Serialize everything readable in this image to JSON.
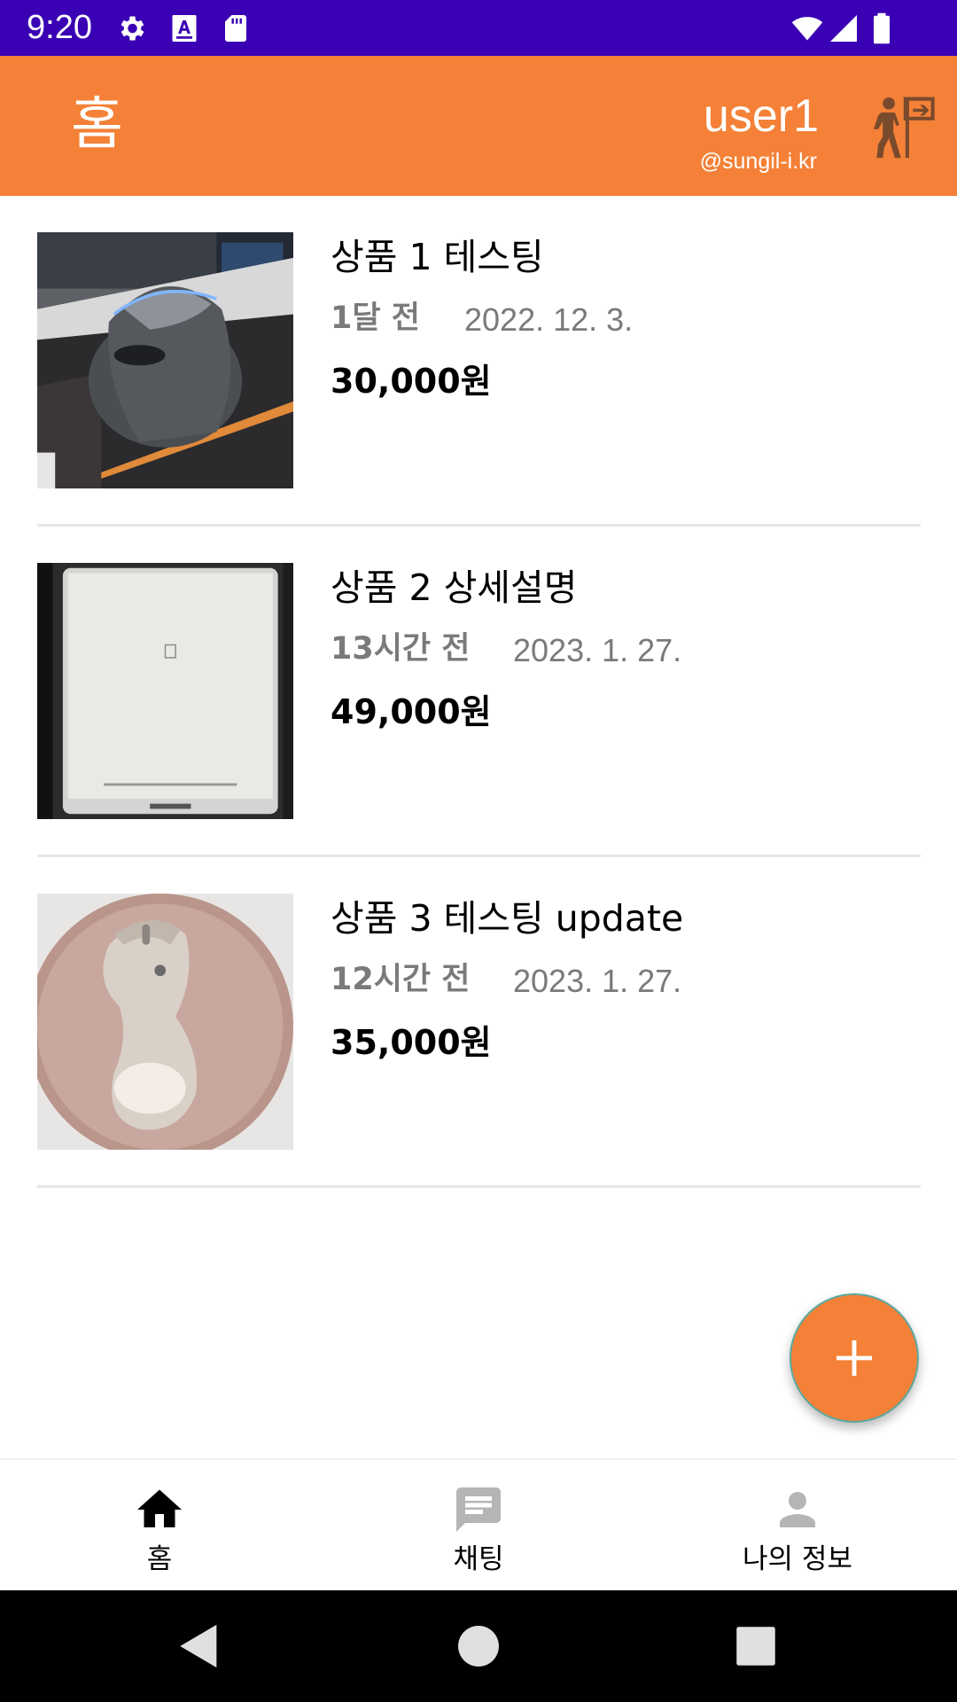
{
  "status_bar": {
    "time": "9:20",
    "left_icons": [
      "settings-icon",
      "a-font-icon",
      "sd-card-icon"
    ],
    "right_icons": [
      "wifi-icon",
      "signal-icon",
      "battery-icon"
    ],
    "background": "#3a00b4"
  },
  "app_bar": {
    "title": "홈",
    "username": "user1",
    "handle": "@sungil-i.kr",
    "action_icon": "logout-exit-icon",
    "background": "#f48137"
  },
  "products": [
    {
      "title": "상품 1 테스팅",
      "ago": "1달 전",
      "date": "2022. 12. 3.",
      "price": "30,000원",
      "image": "vertical-mouse-photo"
    },
    {
      "title": "상품 2  상세설명",
      "ago": "13시간 전",
      "date": "2023. 1. 27.",
      "price": "49,000원",
      "image": "e-reader-photo"
    },
    {
      "title": "상품 3 테스팅 update",
      "ago": "12시간 전",
      "date": "2023. 1. 27.",
      "price": "35,000원",
      "image": "mouse-on-pad-photo"
    }
  ],
  "fab": {
    "icon": "plus-icon",
    "color": "#f48137"
  },
  "bottom_nav": {
    "items": [
      {
        "label": "홈",
        "icon": "home-icon",
        "selected": true
      },
      {
        "label": "채팅",
        "icon": "chat-icon",
        "selected": false
      },
      {
        "label": "나의 정보",
        "icon": "person-icon",
        "selected": false
      }
    ],
    "active_color": "#000000",
    "inactive_icon_color": "#b5b5b5"
  },
  "system_nav": {
    "icons": [
      "back-icon",
      "home-circle-icon",
      "recents-icon"
    ]
  }
}
